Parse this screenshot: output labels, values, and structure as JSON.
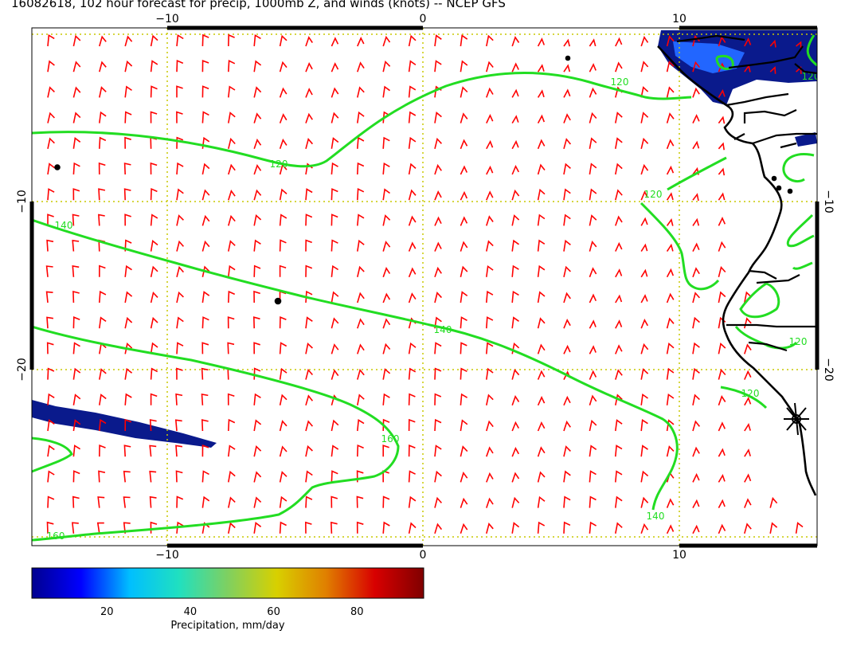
{
  "title": "16082618, 102 hour forecast for precip, 1000mb Z, and winds (knots) -- NCEP GFS",
  "map": {
    "top_axis_ticks": [
      "−10",
      "0",
      "10"
    ],
    "bottom_axis_ticks": [
      "−10",
      "0",
      "10"
    ],
    "left_axis_ticks": [
      "−10",
      "−20"
    ],
    "right_axis_ticks": [
      "−10",
      "−20"
    ],
    "contour_labels": [
      "120",
      "120",
      "120",
      "120",
      "120",
      "120",
      "140",
      "140",
      "160",
      "160",
      "140"
    ],
    "colors": {
      "wind_barbs": "#ff0000",
      "contours": "#22dd22",
      "grid": "#c8c800",
      "coastline": "#000000",
      "precip_low": "#0a1a8c",
      "precip_mid": "#2266ff"
    }
  },
  "colorbar": {
    "ticks": [
      "20",
      "40",
      "60",
      "80"
    ],
    "tick_values": [
      20,
      40,
      60,
      80
    ],
    "range": [
      2,
      96
    ],
    "label": "Precipitation, mm/day",
    "colors": [
      "#00008f",
      "#0000ff",
      "#00bfff",
      "#20e0c0",
      "#7fd060",
      "#d8d000",
      "#e08000",
      "#d80000",
      "#800000"
    ]
  }
}
